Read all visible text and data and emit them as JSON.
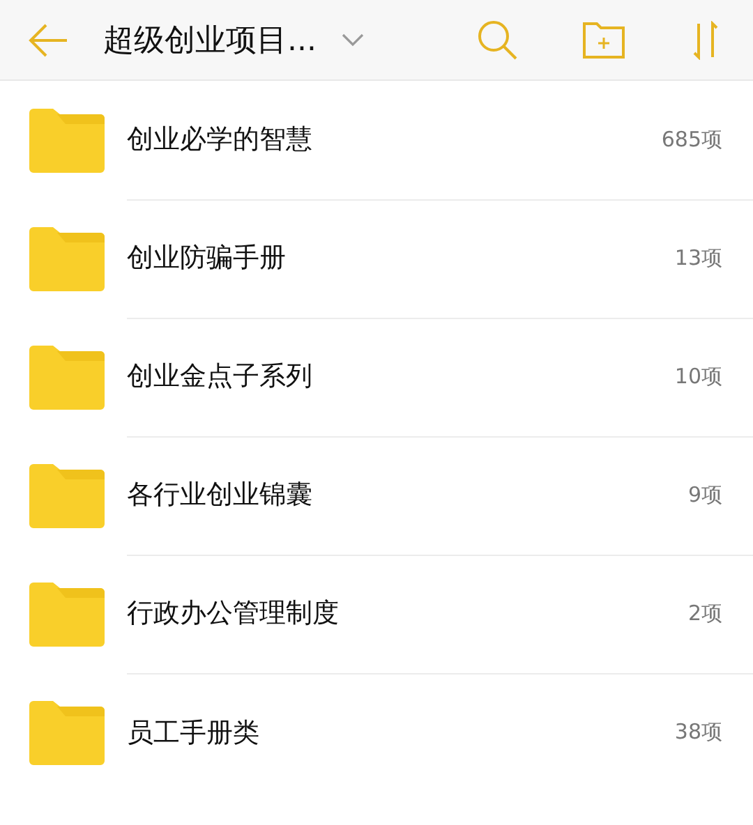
{
  "header": {
    "title": "超级创业项目..."
  },
  "folders": [
    {
      "name": "创业必学的智慧",
      "count": "685项"
    },
    {
      "name": "创业防骗手册",
      "count": "13项"
    },
    {
      "name": "创业金点子系列",
      "count": "10项"
    },
    {
      "name": "各行业创业锦囊",
      "count": "9项"
    },
    {
      "name": "行政办公管理制度",
      "count": "2项"
    },
    {
      "name": "员工手册类",
      "count": "38项"
    }
  ]
}
